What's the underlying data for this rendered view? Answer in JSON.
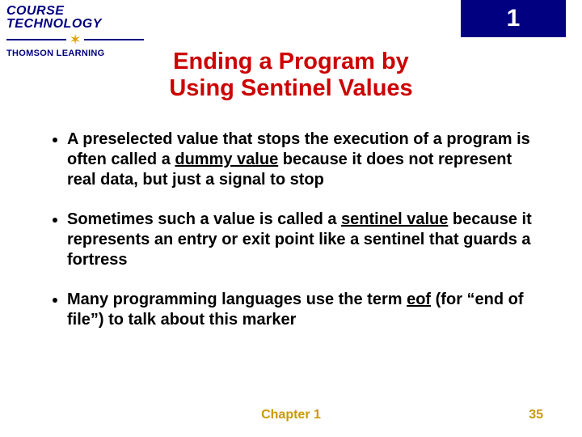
{
  "badge": {
    "number": "1"
  },
  "logo": {
    "line1": "COURSE",
    "line2": "TECHNOLOGY",
    "line3": "THOMSON LEARNING"
  },
  "title": {
    "line1": "Ending a Program by",
    "line2": "Using Sentinel Values"
  },
  "bullets": {
    "b1a": "A preselected value that stops the execution of a program is often called a ",
    "b1u": "dummy value",
    "b1b": " because it does not represent real data, but just a signal to stop",
    "b2a": "Sometimes such a value is called a ",
    "b2u": "sentinel value",
    "b2b": " because it represents an entry or exit point like a sentinel that guards a fortress",
    "b3a": "Many programming languages use the term ",
    "b3u": "eof",
    "b3b": " (for “end of file”) to talk about this marker"
  },
  "footer": {
    "chapter": "Chapter 1",
    "page": "35"
  }
}
